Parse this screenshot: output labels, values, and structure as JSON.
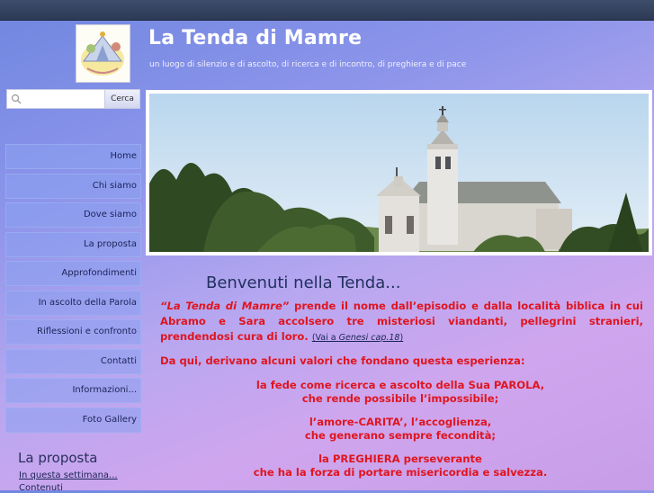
{
  "site": {
    "title": "La Tenda di Mamre",
    "tagline": "un luogo di silenzio e di ascolto, di ricerca e di incontro, di preghiera e di pace"
  },
  "search": {
    "placeholder": "",
    "button_label": "Cerca"
  },
  "nav": {
    "items": [
      {
        "label": "Home"
      },
      {
        "label": "Chi siamo"
      },
      {
        "label": "Dove siamo"
      },
      {
        "label": "La proposta"
      },
      {
        "label": "Approfondimenti"
      },
      {
        "label": "In ascolto della Parola"
      },
      {
        "label": "Riflessioni e confronto"
      },
      {
        "label": "Contatti"
      },
      {
        "label": "Informazioni..."
      },
      {
        "label": "Foto Gallery"
      }
    ]
  },
  "sidebar": {
    "heading": "La proposta",
    "link1": "In questa settimana...",
    "link2": "Contenuti"
  },
  "main": {
    "welcome": "Benvenuti nella Tenda...",
    "intro_name": "“La Tenda di Mamre”",
    "intro_rest": " prende il nome dall’episodio e dalla località biblica in cui Abramo e Sara accolsero tre misteriosi viandanti, pellegrini stranieri, prendendosi cura di loro. ",
    "intro_ref_pre": "(Vai a ",
    "intro_ref_book": "Genesi cap.18",
    "intro_ref_post": ")",
    "values_intro": "Da qui, derivano alcuni valori che fondano questa esperienza:",
    "value1_line1": "la fede come ricerca e ascolto della Sua PAROLA,",
    "value1_line2": "che rende possibile l’impossibile;",
    "value2_line1": "l’amore-CARITA’, l’accoglienza,",
    "value2_line2": "che generano sempre fecondità;",
    "value3_line1": "la PREGHIERA perseverante",
    "value3_line2": "che ha la forza di portare misericordia e salvezza."
  }
}
